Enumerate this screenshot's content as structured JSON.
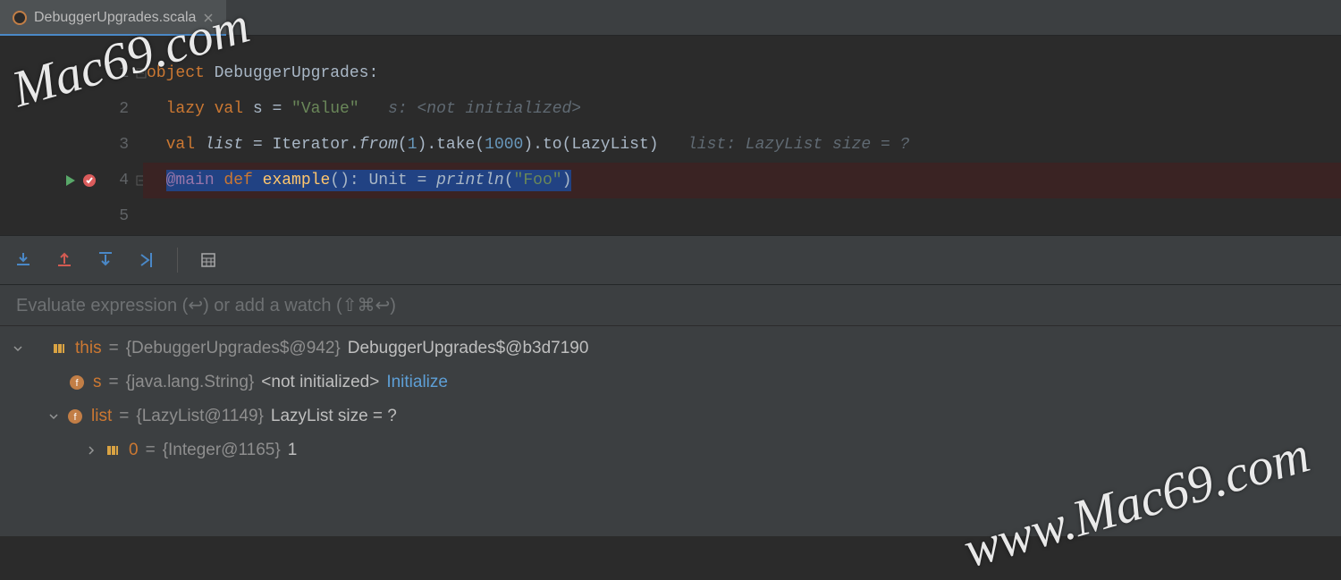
{
  "tab": {
    "filename": "DebuggerUpgrades.scala"
  },
  "code": {
    "lines": [
      "1",
      "2",
      "3",
      "4",
      "5"
    ],
    "l1": {
      "kw": "object",
      "name": " DebuggerUpgrades:"
    },
    "l2": {
      "kw1": "lazy val ",
      "id": "s",
      "eq": " = ",
      "str": "\"Value\"",
      "hint": "   s: <not initialized>"
    },
    "l3": {
      "kw": "val ",
      "id": "list",
      "eq": " = Iterator.",
      "fn1": "from",
      "p1": "(",
      "num1": "1",
      "p2": ").take(",
      "num2": "1000",
      "p3": ").to(LazyList)",
      "hint": "   list: LazyList size = ?"
    },
    "l4": {
      "ann": "@main ",
      "kw": "def ",
      "fn": "example",
      "sig": "(): ",
      "ret": "Unit",
      "eq": " = ",
      "call": "println",
      "p1": "(",
      "str": "\"Foo\"",
      "p2": ")"
    }
  },
  "eval": {
    "placeholder": "Evaluate expression (↩) or add a watch (⇧⌘↩)"
  },
  "vars": {
    "v1": {
      "name": "this",
      "eq": " = ",
      "type": "{DebuggerUpgrades$@942}",
      "val": " DebuggerUpgrades$@b3d7190"
    },
    "v2": {
      "name": "s",
      "eq": " = ",
      "type": "{java.lang.String}",
      "val": " <not initialized> ",
      "link": "Initialize"
    },
    "v3": {
      "name": "list",
      "eq": " = ",
      "type": "{LazyList@1149}",
      "val": " LazyList size = ?"
    },
    "v4": {
      "name": "0",
      "eq": " = ",
      "type": "{Integer@1165}",
      "val": " 1"
    }
  },
  "watermark": {
    "a": "Mac69.com",
    "b": "www.Mac69.com"
  }
}
